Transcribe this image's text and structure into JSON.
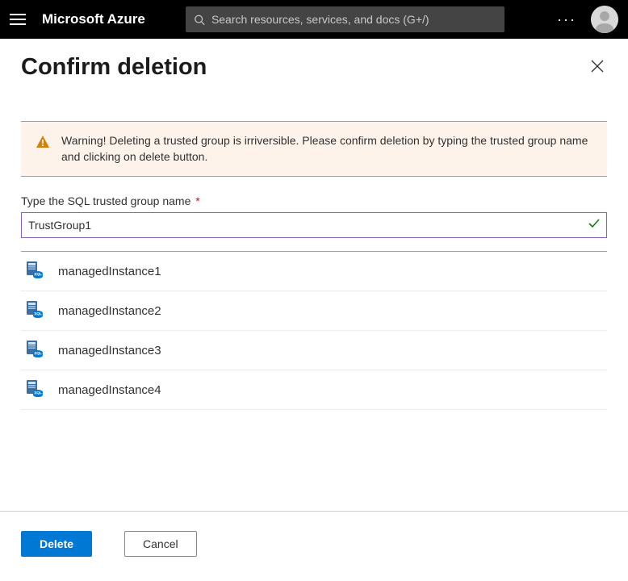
{
  "header": {
    "brand": "Microsoft Azure",
    "search_placeholder": "Search resources, services, and docs (G+/)"
  },
  "page": {
    "title": "Confirm deletion",
    "warning": "Warning! Deleting a trusted group is irriversible. Please confirm deletion by typing the trusted group name and clicking on delete button.",
    "field_label": "Type the SQL trusted group name",
    "input_value": "TrustGroup1",
    "instances": [
      "managedInstance1",
      "managedInstance2",
      "managedInstance3",
      "managedInstance4"
    ]
  },
  "footer": {
    "delete_label": "Delete",
    "cancel_label": "Cancel"
  }
}
